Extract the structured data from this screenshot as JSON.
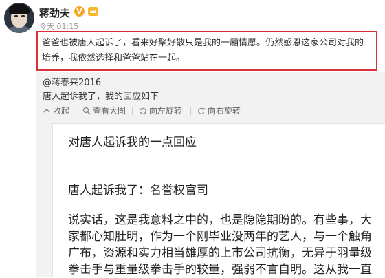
{
  "post": {
    "username": "蒋劲夫",
    "verified_badge": "V",
    "timestamp": "今天 01:15",
    "text": "爸爸也被唐人起诉了，看来好聚好散只是我的一厢情愿。仍然感恩这家公司对我的培养，我依然选择和爸爸站在一起。"
  },
  "repost": {
    "username": "@蒋春来2016",
    "text": "唐人起诉我了，我的回应如下",
    "toolbar": [
      {
        "label": "收起",
        "icon": "collapse-arrow-icon"
      },
      {
        "label": "查看大图",
        "icon": "magnify-icon"
      },
      {
        "label": "向左旋转",
        "icon": "rotate-left-icon"
      },
      {
        "label": "向右旋转",
        "icon": "rotate-right-icon"
      }
    ]
  },
  "article": {
    "title": "对唐人起诉我的一点回应",
    "subtitle": "唐人起诉我了：名誉权官司",
    "lines": [
      "说实话，这是我意料之中的，也是隐隐期盼的。有些事，大",
      "家都心知肚明，作为一个刚毕业没两年的艺人，与一个触角",
      "广布，资源和实力相当雄厚的上市公司抗衡，无异于羽量级",
      "拳击手与重量级拳击手的较量，强弱不言自明。这从我一直"
    ]
  },
  "colors": {
    "highlight_border": "#d9313b",
    "badge": "#f5a623",
    "repost_bg": "#f2f2f2"
  }
}
